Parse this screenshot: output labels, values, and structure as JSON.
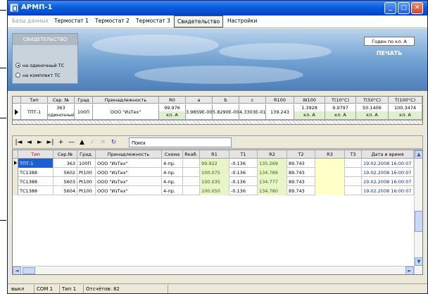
{
  "window": {
    "title": "АРМП-1"
  },
  "menu": {
    "items": [
      {
        "label": "Базы данных",
        "state": "disabled"
      },
      {
        "label": "Термостат 1",
        "state": "normal"
      },
      {
        "label": "Термостат 2",
        "state": "normal"
      },
      {
        "label": "Термостат 3",
        "state": "normal"
      },
      {
        "label": "Свидетельство",
        "state": "active"
      },
      {
        "label": "Настройки",
        "state": "normal"
      }
    ]
  },
  "certificate": {
    "header": "СВИДЕТЕЛЬСТВО",
    "options": [
      {
        "label": "на одиночный ТС",
        "selected": true
      },
      {
        "label": "на комплект ТС",
        "selected": false
      }
    ],
    "valid_label": "Годен по кл. А",
    "print_label": "ПЕЧАТЬ"
  },
  "summary": {
    "headers": [
      "Тип",
      "Сер. №",
      "Град",
      "Принадлежность",
      "R0",
      "a",
      "b",
      "c",
      "R100",
      "W100",
      "T(10°C)",
      "T(50°C)",
      "T(100°C)"
    ],
    "row": {
      "type": "ТПТ-1",
      "serial": "363",
      "serial_note": "одиночный",
      "grad": "100П",
      "owner": "ООО \"ИзТех\"",
      "r0": "99.976",
      "r0_class": "кл. А",
      "a": "3.9859E-003",
      "b": "5.8290E-007",
      "c": "4.3303E-012",
      "r100": "139.243",
      "w100": "1.3928",
      "w100_class": "кл. А",
      "t10": "9.9797",
      "t10_class": "кл. А",
      "t50": "50.1406",
      "t50_class": "кл. А",
      "t100": "100.3474",
      "t100_class": "кл. А"
    }
  },
  "toolbar": {
    "buttons": [
      {
        "name": "first-record-button",
        "glyph": "|◄",
        "enabled": true
      },
      {
        "name": "prior-record-button",
        "glyph": "◄",
        "enabled": true
      },
      {
        "name": "next-record-button",
        "glyph": "►",
        "enabled": true
      },
      {
        "name": "last-record-button",
        "glyph": "►|",
        "enabled": true
      },
      {
        "name": "insert-record-button",
        "glyph": "+",
        "enabled": true
      },
      {
        "name": "delete-record-button",
        "glyph": "—",
        "enabled": true
      },
      {
        "name": "edit-record-button",
        "glyph": "▲",
        "enabled": true
      },
      {
        "name": "post-record-button",
        "glyph": "✓",
        "enabled": false
      },
      {
        "name": "cancel-record-button",
        "glyph": "✕",
        "enabled": false
      },
      {
        "name": "refresh-button",
        "glyph": "↻",
        "enabled": true
      }
    ],
    "search_placeholder": "Поиск"
  },
  "grid": {
    "headers": [
      "Тип",
      "Сер.№",
      "Град.",
      "Принадлежность",
      "Схема",
      "Rкаб.",
      "R1",
      "T1",
      "R2",
      "T2",
      "R3",
      "T3",
      "Дата и время"
    ],
    "rows": [
      {
        "type": "ТПТ-1",
        "serial": "363",
        "grad": "100П",
        "owner": "ООО \"ИзТех\"",
        "scheme": "4-пр.",
        "rcab": "",
        "r1": "99.922",
        "t1": "-0.136",
        "r2": "135.269",
        "t2": "89.743",
        "r3": "",
        "t3": "",
        "date": "19.02.2008 16:00:07",
        "current": true
      },
      {
        "type": "ТС1388",
        "serial": "5602",
        "grad": "Pt100",
        "owner": "ООО \"ИзТех\"",
        "scheme": "4-пр.",
        "rcab": "",
        "r1": "100.075",
        "t1": "-0.136",
        "r2": "134.789",
        "t2": "89.743",
        "r3": "",
        "t3": "",
        "date": "19.02.2008 16:00:07",
        "current": false
      },
      {
        "type": "ТС1388",
        "serial": "5603",
        "grad": "Pt100",
        "owner": "ООО \"ИзТех\"",
        "scheme": "4-пр.",
        "rcab": "",
        "r1": "100.035",
        "t1": "-0.136",
        "r2": "134.777",
        "t2": "89.743",
        "r3": "",
        "t3": "",
        "date": "19.02.2008 16:00:07",
        "current": false
      },
      {
        "type": "ТС1388",
        "serial": "5604",
        "grad": "Pt100",
        "owner": "ООО \"ИзТех\"",
        "scheme": "4-пр.",
        "rcab": "",
        "r1": "100.050",
        "t1": "-0.136",
        "r2": "134.780",
        "t2": "89.743",
        "r3": "",
        "t3": "",
        "date": "19.02.2008 16:00:07",
        "current": false
      }
    ]
  },
  "status": {
    "mode": "выкл",
    "port": "COM 1",
    "type": "Тип 1",
    "count": "Отсчётов: 82"
  },
  "colors": {
    "title_bar": "#0450d0",
    "selection": "#1c5fd0",
    "measured_cell": "#e9f5c8",
    "pending_cell": "#ffffc8"
  }
}
